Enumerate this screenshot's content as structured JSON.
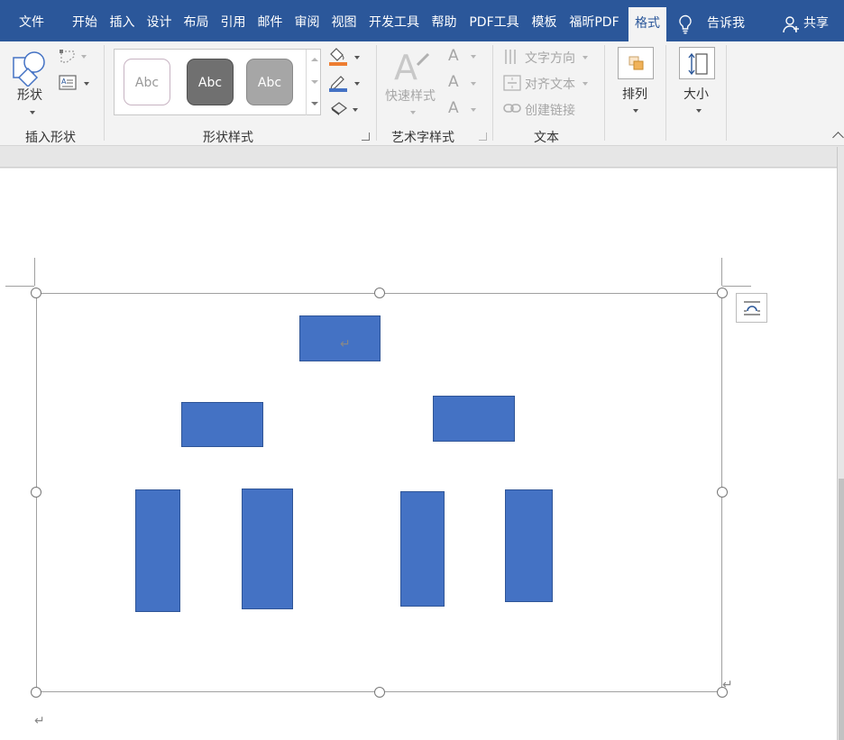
{
  "tabs": [
    "文件",
    "开始",
    "插入",
    "设计",
    "布局",
    "引用",
    "邮件",
    "审阅",
    "视图",
    "开发工具",
    "帮助",
    "PDF工具",
    "模板",
    "福昕PDF",
    "格式"
  ],
  "active_tab": "格式",
  "tell_me": "告诉我",
  "share": "共享",
  "ribbon": {
    "insert_shapes": {
      "shapes_label": "形状",
      "group_label": "插入形状"
    },
    "shape_styles": {
      "thumb_text": [
        "Abc",
        "Abc",
        "Abc"
      ],
      "group_label": "形状样式"
    },
    "wordart_styles": {
      "quick_styles": "快速样式",
      "group_label": "艺术字样式"
    },
    "text": {
      "text_direction": "文字方向",
      "align_text": "对齐文本",
      "create_link": "创建链接",
      "group_label": "文本"
    },
    "arrange": {
      "label": "排列"
    },
    "size": {
      "label": "大小"
    }
  },
  "colors": {
    "tab_bar": "#2b579a",
    "shape_fill": "#4472c4",
    "shape_border": "#2f5597",
    "fill_bar": "#ed7d31",
    "line_bar": "#4472c4"
  },
  "document": {
    "canvas_shape_count": 7,
    "para_mark": "↵"
  }
}
